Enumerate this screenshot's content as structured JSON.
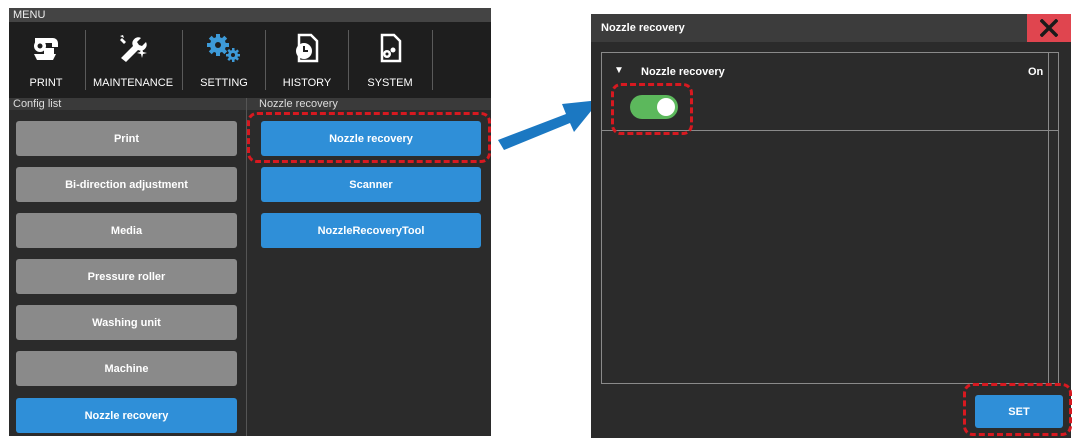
{
  "menu": {
    "title": "MENU",
    "items": [
      {
        "label": "PRINT",
        "icon": "print-icon"
      },
      {
        "label": "MAINTENANCE",
        "icon": "maintenance-icon"
      },
      {
        "label": "SETTING",
        "icon": "setting-gears-icon"
      },
      {
        "label": "HISTORY",
        "icon": "history-icon"
      },
      {
        "label": "SYSTEM",
        "icon": "system-icon"
      }
    ]
  },
  "config_list": {
    "header": "Config list",
    "items": [
      "Print",
      "Bi-direction adjustment",
      "Media",
      "Pressure roller",
      "Washing unit",
      "Machine",
      "Nozzle recovery"
    ],
    "selected": "Nozzle recovery"
  },
  "submenu": {
    "header": "Nozzle recovery",
    "items": [
      "Nozzle recovery",
      "Scanner",
      "NozzleRecoveryTool"
    ]
  },
  "dialog": {
    "title": "Nozzle recovery",
    "close_icon": "close-icon",
    "row": {
      "caret": "▼",
      "label": "Nozzle recovery",
      "state": "On",
      "toggle_on": true
    },
    "set_label": "SET"
  },
  "colors": {
    "accent_blue": "#2f8fd8",
    "toggle_green": "#5cb85c",
    "highlight_red": "#d71920",
    "close_red": "#e0454f"
  }
}
